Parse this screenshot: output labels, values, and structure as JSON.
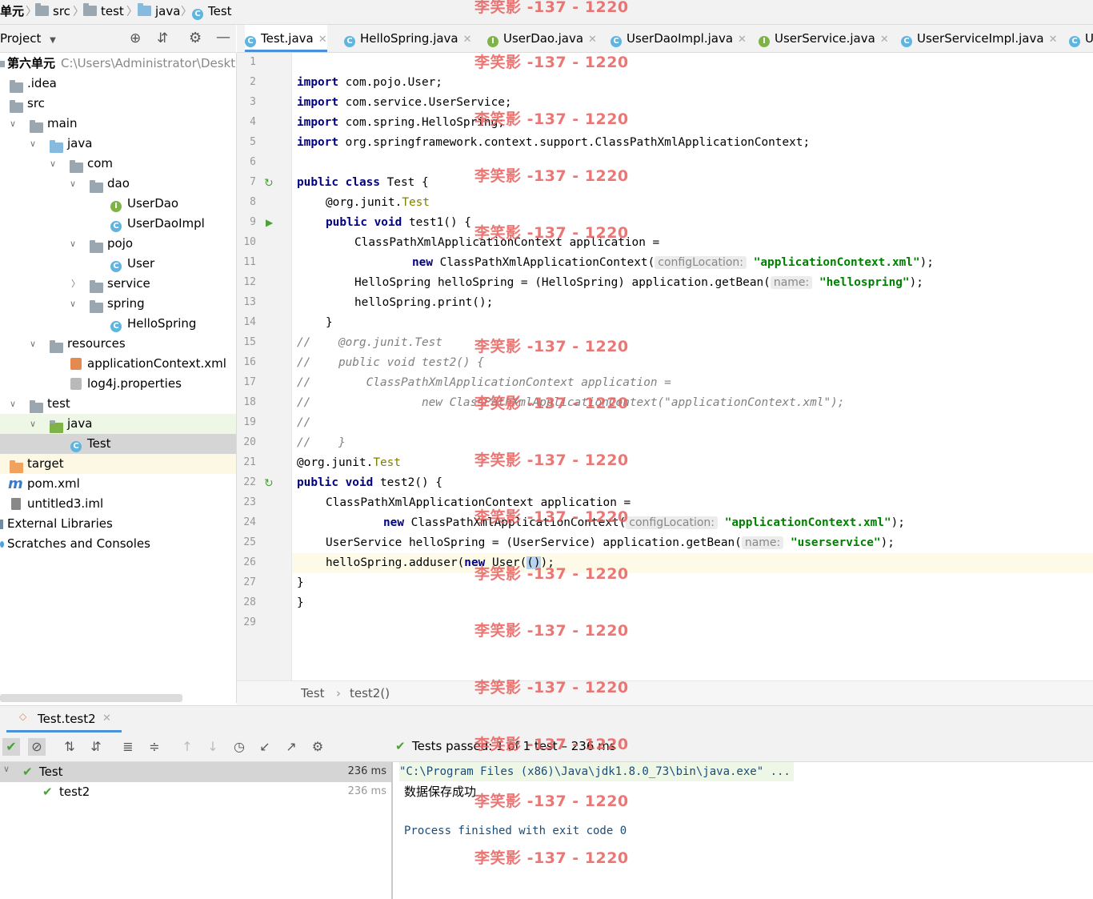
{
  "breadcrumb": [
    "单元",
    "src",
    "test",
    "java",
    "Test"
  ],
  "project_panel": {
    "title": "Project"
  },
  "tabs": [
    {
      "label": "Test.java",
      "icon": "class-icon"
    },
    {
      "label": "HelloSpring.java",
      "icon": "class-icon"
    },
    {
      "label": "UserDao.java",
      "icon": "interface-icon"
    },
    {
      "label": "UserDaoImpl.java",
      "icon": "class-icon"
    },
    {
      "label": "UserService.java",
      "icon": "interface-icon"
    },
    {
      "label": "UserServiceImpl.java",
      "icon": "class-icon"
    },
    {
      "label": "U",
      "icon": "class-icon"
    }
  ],
  "tree": [
    {
      "label": "第六单元",
      "extra": "C:\\Users\\Administrator\\Deskto"
    },
    {
      "label": ".idea"
    },
    {
      "label": "src"
    },
    {
      "label": "main"
    },
    {
      "label": "java"
    },
    {
      "label": "com"
    },
    {
      "label": "dao"
    },
    {
      "label": "UserDao"
    },
    {
      "label": "UserDaoImpl"
    },
    {
      "label": "pojo"
    },
    {
      "label": "User"
    },
    {
      "label": "service"
    },
    {
      "label": "spring"
    },
    {
      "label": "HelloSpring"
    },
    {
      "label": "resources"
    },
    {
      "label": "applicationContext.xml"
    },
    {
      "label": "log4j.properties"
    },
    {
      "label": "test"
    },
    {
      "label": "java"
    },
    {
      "label": "Test"
    },
    {
      "label": "target"
    },
    {
      "label": "pom.xml"
    },
    {
      "label": "untitled3.iml"
    },
    {
      "label": "External Libraries"
    },
    {
      "label": "Scratches and Consoles"
    }
  ],
  "line_numbers": [
    "1",
    "2",
    "3",
    "4",
    "5",
    "6",
    "7",
    "8",
    "9",
    "10",
    "11",
    "12",
    "13",
    "14",
    "15",
    "16",
    "17",
    "18",
    "19",
    "20",
    "21",
    "22",
    "23",
    "24",
    "25",
    "26",
    "27",
    "28",
    "29"
  ],
  "code": {
    "l2_kw": "import",
    "l2": " com.pojo.User;",
    "l3_kw": "import",
    "l3": " com.service.UserService;",
    "l4_kw": "import",
    "l4": " com.spring.HelloSpring;",
    "l5_kw": "import",
    "l5": " org.springframework.context.support.ClassPathXmlApplicationContext;",
    "l7_kw": "public class",
    "l7": " Test {",
    "l8_a": "@org.junit.",
    "l8_b": "Test",
    "l9_kw": "public void",
    "l9": " test1() {",
    "l10": "ClassPathXmlApplicationContext application =",
    "l11_kw": "new",
    "l11": " ClassPathXmlApplicationContext(",
    "l11_hint": "configLocation:",
    "l11_str": "\"applicationContext.xml\"",
    "l11_end": ");",
    "l12": "HelloSpring helloSpring = (HelloSpring) application.getBean(",
    "l12_hint": "name:",
    "l12_str": "\"hellospring\"",
    "l12_end": ");",
    "l13": "helloSpring.print();",
    "l14": "}",
    "l15": "//    @org.junit.Test",
    "l16": "//    public void test2() {",
    "l17": "//        ClassPathXmlApplicationContext application =",
    "l18": "//                new ClassPathXmlApplicationContext(\"applicationContext.xml\");",
    "l19": "//",
    "l20": "//    }",
    "l21_a": "@org.junit.",
    "l21_b": "Test",
    "l22_kw": "public void",
    "l22": " test2() {",
    "l23": "ClassPathXmlApplicationContext application =",
    "l24_kw": "new",
    "l24": " ClassPathXmlApplicationContext(",
    "l24_hint": "configLocation:",
    "l24_str": "\"applicationContext.xml\"",
    "l24_end": ");",
    "l25": "UserService helloSpring = (UserService) application.getBean(",
    "l25_hint": "name:",
    "l25_str": "\"userservice\"",
    "l25_end": ");",
    "l26_a": "helloSpring.adduser(",
    "l26_kw": "new",
    "l26_b": " User(",
    "l26_c": "()",
    "l26_d": ");",
    "l27": "}",
    "l28": "}"
  },
  "editor_breadcrumb": [
    "Test",
    "test2()"
  ],
  "run": {
    "tab": "Test.test2",
    "status": "Tests passed: 1 of 1 test – 236 ms",
    "results": [
      {
        "name": "Test",
        "time": "236 ms"
      },
      {
        "name": "test2",
        "time": "236 ms"
      }
    ],
    "console": [
      "\"C:\\Program Files (x86)\\Java\\jdk1.8.0_73\\bin\\java.exe\" ...",
      "数据保存成功",
      "Process finished with exit code 0"
    ]
  },
  "watermark": "李笑影 -137 - 1220",
  "colors": {
    "keyword": "#000080",
    "string": "#008000",
    "annotation": "#808000",
    "comment": "#808080",
    "success": "#4c9f3a",
    "watermark": "#e8605e"
  }
}
